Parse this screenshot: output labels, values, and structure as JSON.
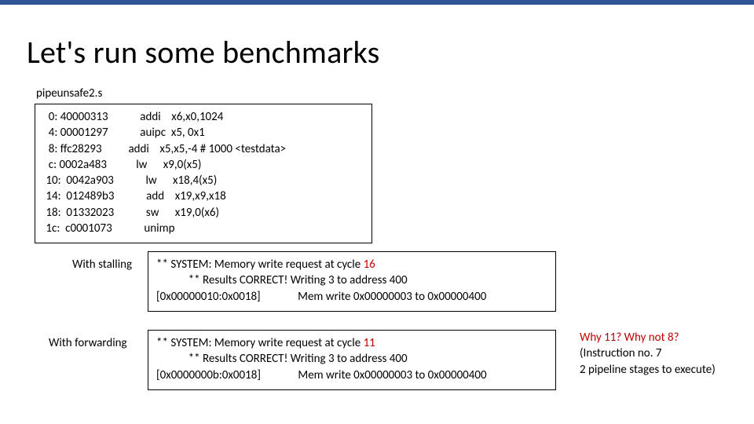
{
  "title": "Let's run some benchmarks",
  "filename": "pipeunsafe2.s",
  "code": {
    "l0": "  0: 40000313            addi    x6,x0,1024",
    "l1": "  4: 00001297            auipc  x5, 0x1",
    "l2": "  8: ffc28293          addi    x5,x5,-4 # 1000 <testdata>",
    "l3": "  c: 0002a483           lw      x9,0(x5)",
    "l4": " 10:  0042a903            lw      x18,4(x5)",
    "l5": " 14:  012489b3            add    x19,x9,x18",
    "l6": " 18:  01332023            sw      x19,0(x6)",
    "l7": " 1c:  c0001073            unimp"
  },
  "labels": {
    "stalling": "With stalling",
    "forwarding": "With forwarding"
  },
  "stall": {
    "line1a": "** SYSTEM: Memory write request at cycle ",
    "line1b": "16",
    "line2": "            ** Results CORRECT! Writing 3 to address 400",
    "line3": "[0x00000010:0x0018]              Mem write 0x00000003 to 0x00000400"
  },
  "fwd": {
    "line1a": "** SYSTEM: Memory write request at cycle ",
    "line1b": "11",
    "line2": "            ** Results CORRECT! Writing 3 to address 400",
    "line3": "[0x0000000b:0x0018]              Mem write 0x00000003 to 0x00000400"
  },
  "note": {
    "q": "Why 11?  Why not 8?",
    "a1": "(Instruction no. 7",
    "a2": "2 pipeline stages to execute)"
  }
}
